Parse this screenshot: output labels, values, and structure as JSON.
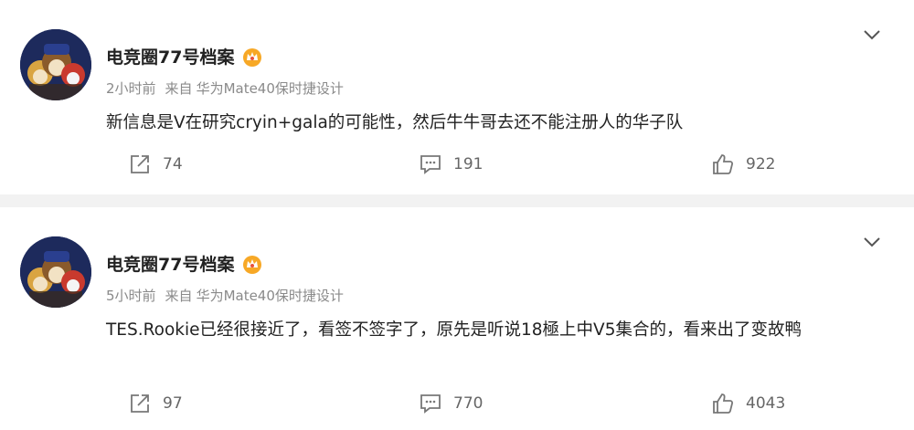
{
  "posts": [
    {
      "username": "电竞圈77号档案",
      "time": "2小时前",
      "source_prefix": "来自",
      "source": "华为Mate40保时捷设计",
      "content": "新信息是V在研究cryin+gala的可能性，然后牛牛哥去还不能注册人的华子队",
      "reposts": "74",
      "comments": "191",
      "likes": "922"
    },
    {
      "username": "电竞圈77号档案",
      "time": "5小时前",
      "source_prefix": "来自",
      "source": "华为Mate40保时捷设计",
      "content": "TES.Rookie已经很接近了，看签不签字了，原先是听说18極上中V5集合的，看来出了变故鸭",
      "reposts": "97",
      "comments": "770",
      "likes": "4043"
    }
  ],
  "icons": {
    "expand": "chevron-down-icon",
    "vip": "crown-icon",
    "repost": "share-icon",
    "comment": "comment-icon",
    "like": "thumbs-up-icon"
  },
  "colors": {
    "background": "#f2f2f2",
    "card": "#ffffff",
    "vip_gold": "#f7a826"
  }
}
